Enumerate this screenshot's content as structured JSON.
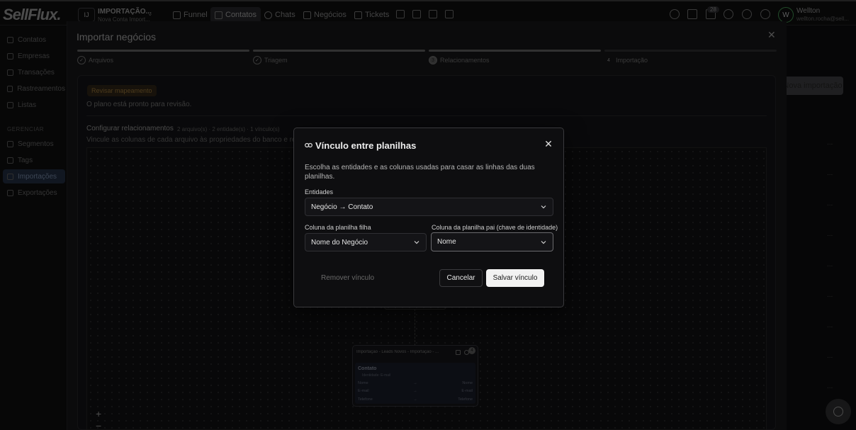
{
  "app": {
    "logo": "SellFlux."
  },
  "workspace": {
    "initials": "IJ",
    "name": "IMPORTAÇÃO...",
    "subtitle": "Nova Conta Import..."
  },
  "nav": {
    "items": [
      {
        "label": "Funnel"
      },
      {
        "label": "Contatos"
      },
      {
        "label": "Chats"
      },
      {
        "label": "Negócios"
      },
      {
        "label": "Tickets"
      }
    ]
  },
  "user": {
    "initial": "W",
    "name": "Wellton",
    "email": "wellton.rocha@sell...",
    "notification_count": "28"
  },
  "sidebar": {
    "items": [
      {
        "label": "Contatos"
      },
      {
        "label": "Empresas"
      },
      {
        "label": "Transações"
      },
      {
        "label": "Rastreamentos"
      },
      {
        "label": "Listas"
      }
    ],
    "section_label": "GERENCIAR",
    "manage_items": [
      {
        "label": "Segmentos"
      },
      {
        "label": "Tags"
      },
      {
        "label": "Importações"
      },
      {
        "label": "Exportações"
      }
    ]
  },
  "background_page": {
    "import_button": "Nova importação",
    "row_menu": "..."
  },
  "import_panel": {
    "title": "Importar negócios",
    "steps": [
      {
        "num": "✓",
        "label": "Arquivos"
      },
      {
        "num": "✓",
        "label": "Triagem"
      },
      {
        "num": "3",
        "label": "Relacionamentos"
      },
      {
        "num": "4",
        "label": "Importação"
      }
    ],
    "review_badge": "Revisar mapeamento",
    "review_text": "O plano está pronto para revisão.",
    "relationships_title": "Configurar relacionamentos",
    "relationships_meta": "2 arquivo(s) · 2 entidade(s) · 1 vínculo(s)",
    "relationships_desc": "Vincule as colunas de cada arquivo às propriedades do banco e re",
    "zoom_in": "+",
    "zoom_out": "−",
    "node": {
      "header": "Importação - Leads Novos - Importação - ...",
      "badge": "4",
      "entity": "Contato",
      "identity": "Identidade: E-mail",
      "rows": [
        {
          "left": "Nome",
          "mid": "→",
          "right": "Nome"
        },
        {
          "left": "E-mail",
          "mid": "→",
          "right": "E-mail"
        },
        {
          "left": "Telefone",
          "mid": "→",
          "right": "Telefone"
        }
      ]
    }
  },
  "modal": {
    "title": "Vínculo entre planilhas",
    "description": "Escolha as entidades e as colunas usadas para casar as linhas das duas planilhas.",
    "entities_label": "Entidades",
    "entities_value": "Negócio → Contato",
    "child_column_label": "Coluna da planilha filha",
    "child_column_value": "Nome do Negócio",
    "parent_column_label": "Coluna da planilha pai (chave de identidade)",
    "parent_column_value": "Nome",
    "remove_label": "Remover vínculo",
    "cancel_label": "Cancelar",
    "save_label": "Salvar vínculo"
  }
}
